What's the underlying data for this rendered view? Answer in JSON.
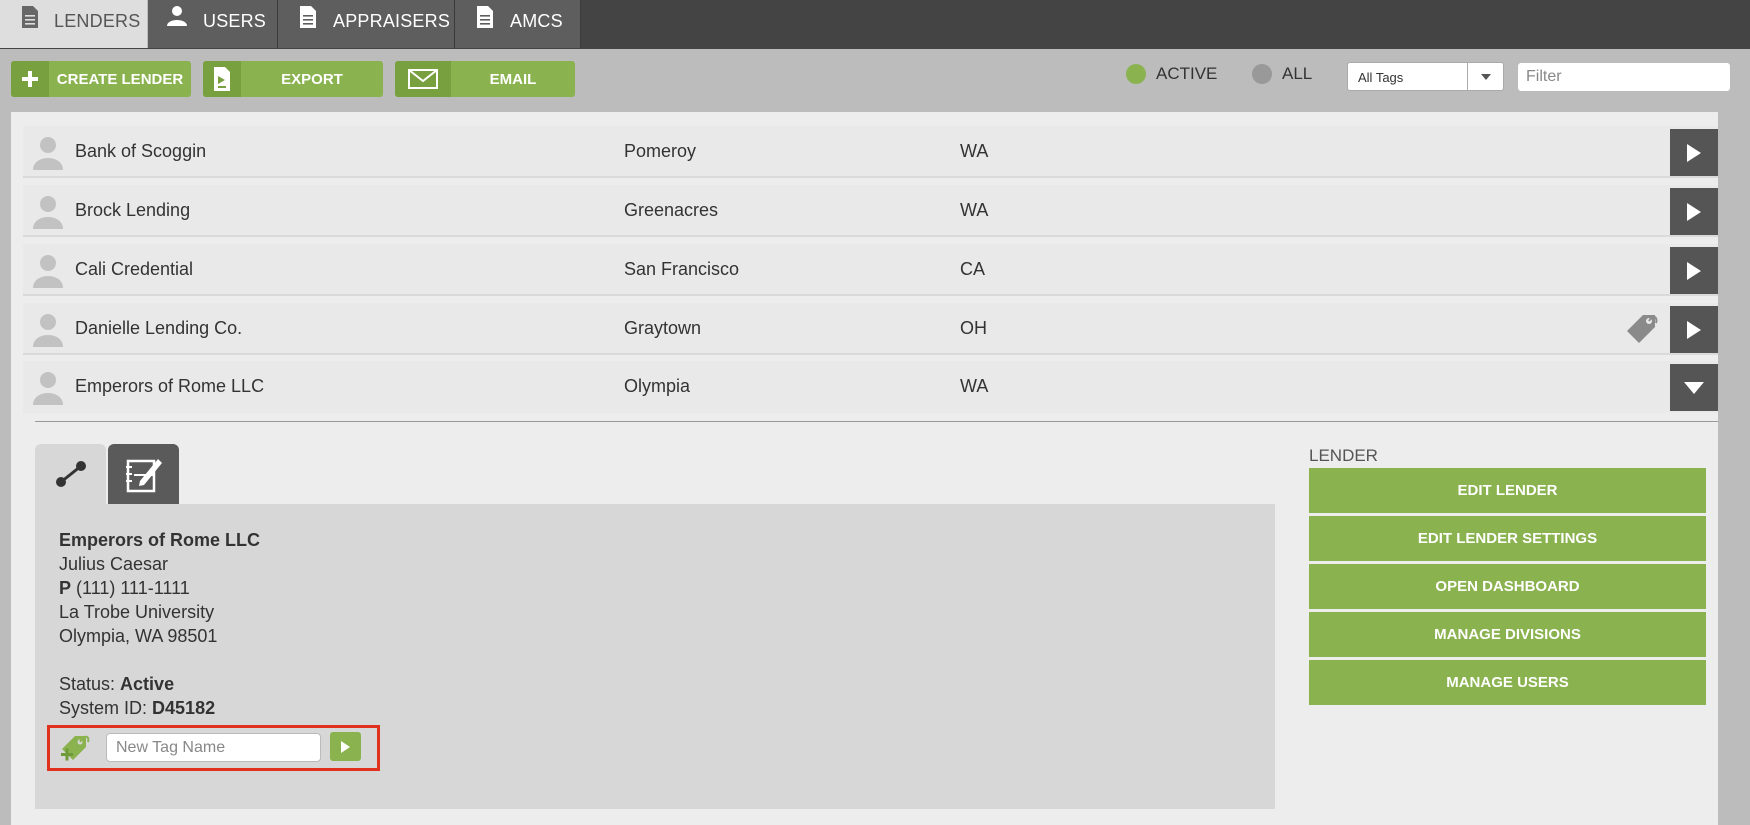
{
  "tabs": [
    {
      "label": "LENDERS",
      "icon": "document-icon",
      "active": true
    },
    {
      "label": "USERS",
      "icon": "user-icon",
      "active": false
    },
    {
      "label": "APPRAISERS",
      "icon": "document-icon",
      "active": false
    },
    {
      "label": "AMCS",
      "icon": "document-icon",
      "active": false
    }
  ],
  "toolbar": {
    "create_label": "CREATE LENDER",
    "export_label": "EXPORT",
    "email_label": "EMAIL"
  },
  "filters": {
    "active_label": "ACTIVE",
    "all_label": "ALL",
    "tags_selected": "All Tags",
    "filter_placeholder": "Filter"
  },
  "lenders": [
    {
      "name": "Bank of Scoggin",
      "city": "Pomeroy",
      "state": "WA",
      "tagged": false,
      "expanded": false
    },
    {
      "name": "Brock Lending",
      "city": "Greenacres",
      "state": "WA",
      "tagged": false,
      "expanded": false
    },
    {
      "name": "Cali Credential",
      "city": "San Francisco",
      "state": "CA",
      "tagged": false,
      "expanded": false
    },
    {
      "name": "Danielle Lending Co.",
      "city": "Graytown",
      "state": "OH",
      "tagged": true,
      "expanded": false
    },
    {
      "name": "Emperors of Rome LLC",
      "city": "Olympia",
      "state": "WA",
      "tagged": false,
      "expanded": true
    }
  ],
  "detail": {
    "company": "Emperors of Rome LLC",
    "contact": "Julius Caesar",
    "phone_label": "P",
    "phone": "(111) 111-1111",
    "address1": "La Trobe University",
    "address2": "Olympia, WA 98501",
    "status_label": "Status:",
    "status": "Active",
    "system_id_label": "System ID:",
    "system_id": "D45182",
    "tag_placeholder": "New Tag Name"
  },
  "sidebar": {
    "title": "LENDER",
    "actions": [
      "EDIT LENDER",
      "EDIT LENDER SETTINGS",
      "OPEN DASHBOARD",
      "MANAGE DIVISIONS",
      "MANAGE USERS"
    ]
  },
  "colors": {
    "accent": "#8ab24f",
    "dark_button": "#555555",
    "tabbar": "#444444",
    "highlight": "#e0301e"
  }
}
